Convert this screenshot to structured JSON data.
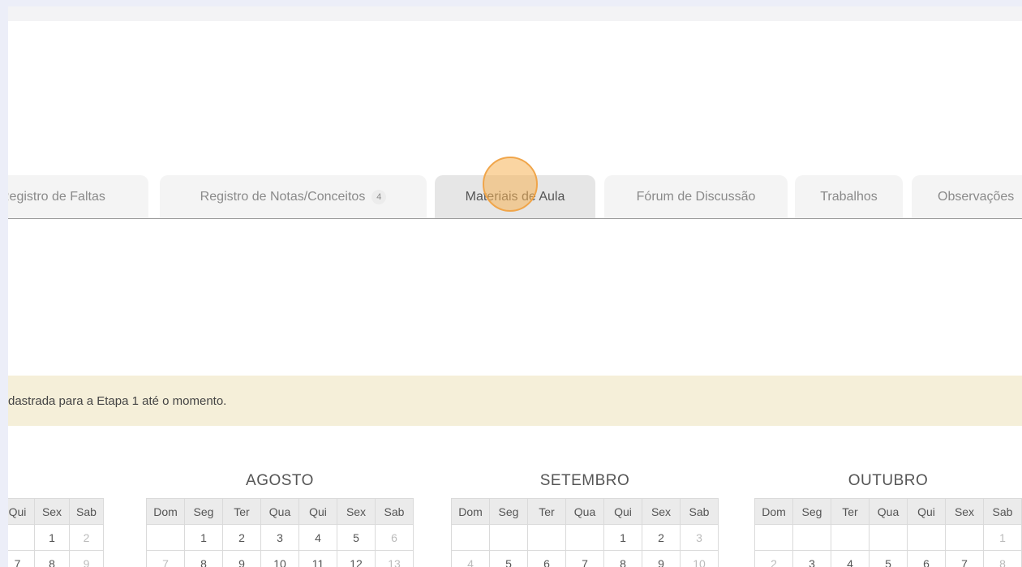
{
  "tabs": [
    {
      "label": "Registro de Faltas",
      "active": false
    },
    {
      "label": "Registro de Notas/Conceitos",
      "badge": "4",
      "active": false
    },
    {
      "label": "Materiais de Aula",
      "active": true
    },
    {
      "label": "Fórum de Discussão",
      "active": false
    },
    {
      "label": "Trabalhos",
      "active": false
    },
    {
      "label": "Observações",
      "active": false
    }
  ],
  "notice": {
    "text": "dastrada para a Etapa 1 até o momento."
  },
  "calendar": {
    "partial": {
      "headers": [
        "Qui",
        "Sex",
        "Sab"
      ],
      "rows": [
        [
          "",
          "1",
          "2"
        ],
        [
          "7",
          "8",
          "9"
        ]
      ]
    },
    "months": [
      {
        "title": "AGOSTO",
        "headers": [
          "Dom",
          "Seg",
          "Ter",
          "Qua",
          "Qui",
          "Sex",
          "Sab"
        ],
        "rows": [
          [
            "",
            "1",
            "2",
            "3",
            "4",
            "5",
            "6"
          ],
          [
            "7",
            "8",
            "9",
            "10",
            "11",
            "12",
            "13"
          ]
        ]
      },
      {
        "title": "SETEMBRO",
        "headers": [
          "Dom",
          "Seg",
          "Ter",
          "Qua",
          "Qui",
          "Sex",
          "Sab"
        ],
        "rows": [
          [
            "",
            "",
            "",
            "",
            "1",
            "2",
            "3"
          ],
          [
            "4",
            "5",
            "6",
            "7",
            "8",
            "9",
            "10"
          ]
        ]
      },
      {
        "title": "OUTUBRO",
        "headers": [
          "Dom",
          "Seg",
          "Ter",
          "Qua",
          "Qui",
          "Sex",
          "Sab"
        ],
        "rows": [
          [
            "",
            "",
            "",
            "",
            "",
            "",
            "1"
          ],
          [
            "2",
            "3",
            "4",
            "5",
            "6",
            "7",
            "8"
          ]
        ]
      }
    ]
  },
  "colors": {
    "notice_bg": "#f5efd9",
    "click_marker": "#f0a54a",
    "page_bg": "#eceef8"
  }
}
